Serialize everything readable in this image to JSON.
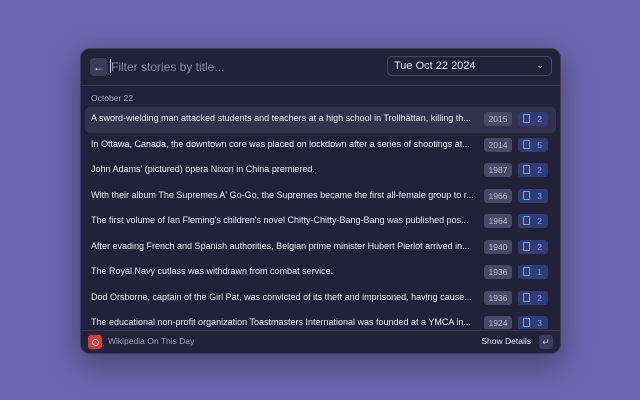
{
  "search": {
    "placeholder": "Filter stories by title...",
    "value": ""
  },
  "date_select": {
    "value": "Tue Oct 22 2024",
    "chevron_icon": "chevron-down-icon"
  },
  "section": {
    "title": "October 22"
  },
  "stories": [
    {
      "title": "A sword-wielding man attacked students and teachers at a high school in Trollhättan, killing th...",
      "year": "2015",
      "pages": "2",
      "selected": true
    },
    {
      "title": "In Ottawa, Canada, the downtown core was placed on lockdown after a series of shootings at...",
      "year": "2014",
      "pages": "5"
    },
    {
      "title": "John Adams' (pictured) opera Nixon in China premiered.",
      "year": "1987",
      "pages": "2"
    },
    {
      "title": "With their album The Supremes A' Go-Go, the Supremes became the first all-female group to r...",
      "year": "1966",
      "pages": "3"
    },
    {
      "title": "The first volume of Ian Fleming's children's novel Chitty-Chitty-Bang-Bang was published pos...",
      "year": "1964",
      "pages": "2"
    },
    {
      "title": "After evading French and Spanish authorities, Belgian prime minister Hubert Pierlot arrived in...",
      "year": "1940",
      "pages": "2"
    },
    {
      "title": "The Royal Navy cutlass  was withdrawn from combat service.",
      "year": "1936",
      "pages": "1"
    },
    {
      "title": "Dod Orsborne, captain of the Girl Pat, was convicted of its theft and imprisoned, having cause...",
      "year": "1936",
      "pages": "2"
    },
    {
      "title": "The educational non-profit organization Toastmasters International was founded at a YMCA in...",
      "year": "1924",
      "pages": "3"
    }
  ],
  "footer": {
    "app_name": "Wikipedia On This Day",
    "primary_action": "Show Details",
    "enter_key": "↵"
  },
  "colors": {
    "background": "#6a66ae",
    "window": "#23213a",
    "accent": "#7e9cf0",
    "logo": "#d13f3f"
  }
}
